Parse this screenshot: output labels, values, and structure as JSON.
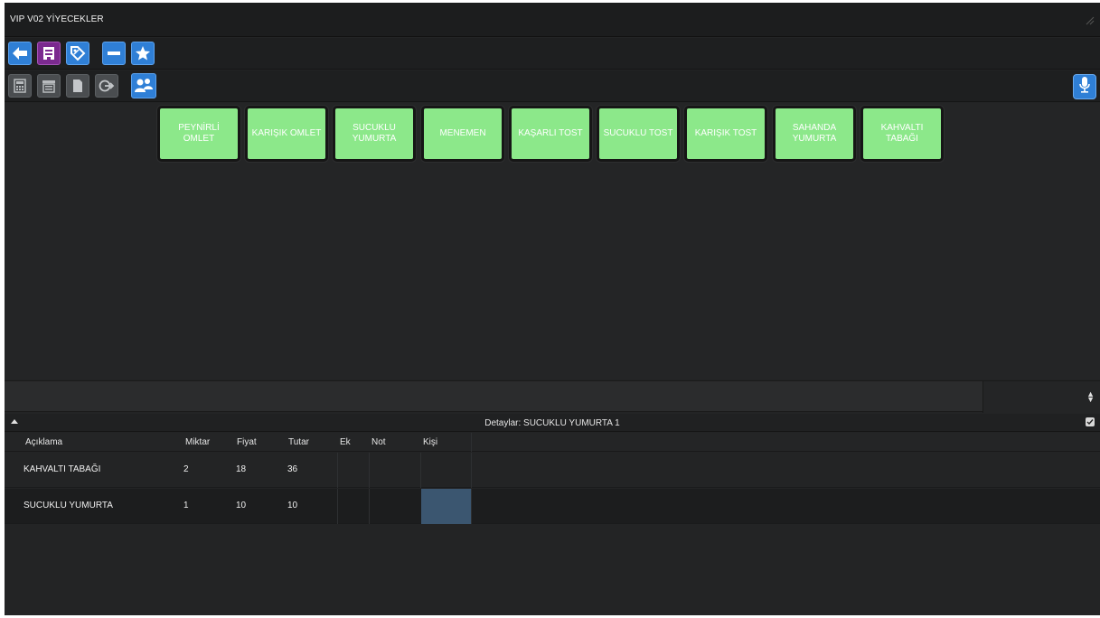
{
  "window": {
    "title": "VIP  V02 YİYECEKLER"
  },
  "toolbar_top": {
    "buttons": [
      {
        "icon": "arrow-left-icon",
        "color": "#2f7fd6"
      },
      {
        "icon": "receipt-icon",
        "color": "#7b2a8f"
      },
      {
        "icon": "tag-icon",
        "color": "#2f7fd6"
      },
      {
        "icon": "minus-icon",
        "color": "#2f7fd6"
      },
      {
        "icon": "star-icon",
        "color": "#2f7fd6"
      }
    ]
  },
  "toolbar_bottom": {
    "buttons": [
      {
        "icon": "calculator-icon",
        "color": "#4a4d50"
      },
      {
        "icon": "printer-icon",
        "color": "#4a4d50"
      },
      {
        "icon": "document-icon",
        "color": "#4a4d50"
      },
      {
        "icon": "exit-icon",
        "color": "#4a4d50"
      },
      {
        "icon": "users-icon",
        "color": "#2f7fd6"
      }
    ],
    "mic_icon": "microphone-icon"
  },
  "products": [
    {
      "label": "PEYNİRLİ OMLET"
    },
    {
      "label": "KARIŞIK OMLET"
    },
    {
      "label": "SUCUKLU YUMURTA"
    },
    {
      "label": "MENEMEN"
    },
    {
      "label": "KAŞARLI TOST"
    },
    {
      "label": "SUCUKLU TOST"
    },
    {
      "label": "KARIŞIK TOST"
    },
    {
      "label": "SAHANDA YUMURTA"
    },
    {
      "label": "KAHVALTI TABAĞI"
    }
  ],
  "product_color": "#8ce88a",
  "details": {
    "title": "Detaylar: SUCUKLU YUMURTA 1",
    "columns": [
      "Açıklama",
      "Miktar",
      "Fiyat",
      "Tutar",
      "Ek",
      "Not",
      "Kişi"
    ],
    "rows": [
      {
        "aciklama": "KAHVALTI TABAĞI",
        "miktar": "2",
        "fiyat": "18",
        "tutar": "36",
        "ek": "",
        "not": "",
        "kisi": ""
      },
      {
        "aciklama": "SUCUKLU YUMURTA",
        "miktar": "1",
        "fiyat": "10",
        "tutar": "10",
        "ek": "",
        "not": "",
        "kisi": ""
      }
    ]
  }
}
